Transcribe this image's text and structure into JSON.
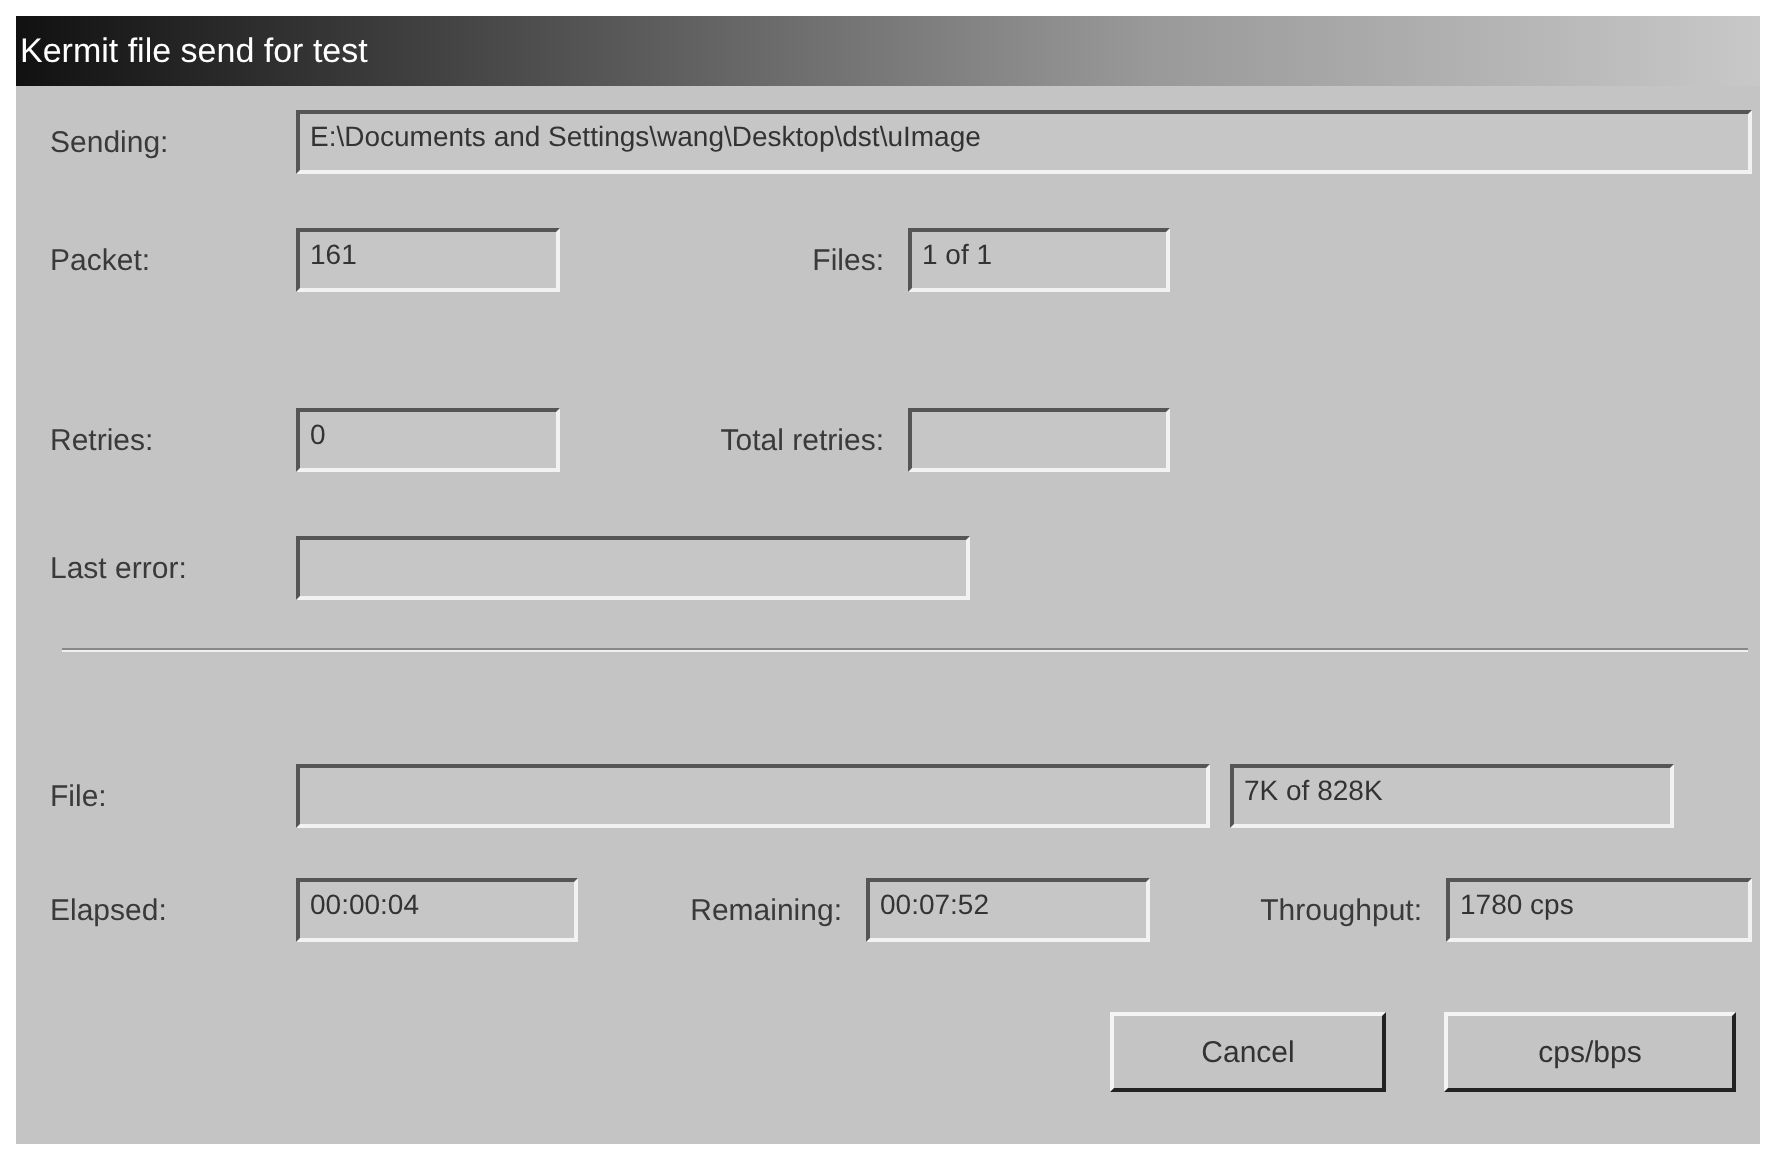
{
  "window": {
    "title": "Kermit file send for test"
  },
  "sending": {
    "label": "Sending:",
    "value": "E:\\Documents and Settings\\wang\\Desktop\\dst\\uImage"
  },
  "packet": {
    "label": "Packet:",
    "value": "161"
  },
  "files": {
    "label": "Files:",
    "value": "1 of 1"
  },
  "retries": {
    "label": "Retries:",
    "value": "0"
  },
  "total_retries": {
    "label": "Total retries:"
  },
  "last_error": {
    "label": "Last error:"
  },
  "file": {
    "label": "File:",
    "size": "7K of 828K"
  },
  "elapsed": {
    "label": "Elapsed:",
    "value": "00:00:04"
  },
  "remaining": {
    "label": "Remaining:",
    "value": "00:07:52"
  },
  "throughput": {
    "label": "Throughput:",
    "value": "1780 cps"
  },
  "buttons": [
    "Cancel",
    "cps/bps"
  ]
}
